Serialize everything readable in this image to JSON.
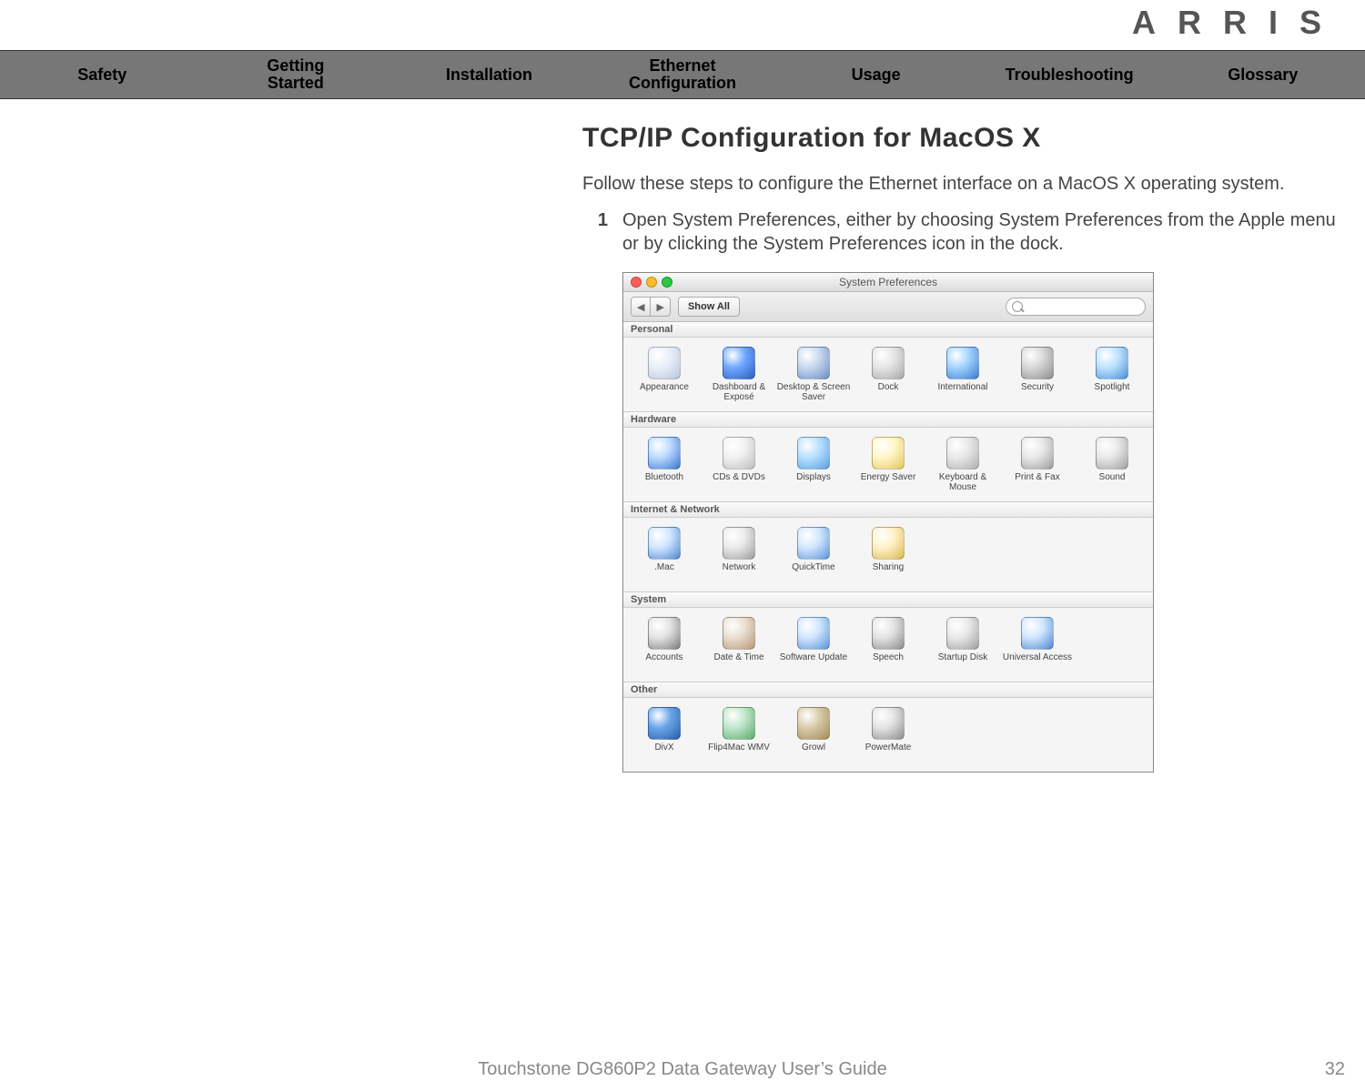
{
  "brand": "ARRIS",
  "nav": {
    "items": [
      {
        "label": "Safety"
      },
      {
        "label": "Getting\nStarted"
      },
      {
        "label": "Installation"
      },
      {
        "label": "Ethernet\nConfiguration"
      },
      {
        "label": "Usage"
      },
      {
        "label": "Troubleshooting"
      },
      {
        "label": "Glossary"
      }
    ]
  },
  "page": {
    "heading": "TCP/IP Configuration for MacOS X",
    "intro": "Follow these steps to configure the Ethernet interface on a MacOS X operating system.",
    "step1_num": "1",
    "step1_txt": "Open System Preferences, either by choosing System Preferences from the Apple menu or by clicking the System Preferences icon in the dock."
  },
  "sys_prefs": {
    "window_title": "System Preferences",
    "toolbar": {
      "show_all": "Show All",
      "search_placeholder": ""
    },
    "sections": [
      {
        "title": "Personal",
        "items": [
          {
            "label": "Appearance",
            "glyph": "",
            "c1": "#e9eef7",
            "c2": "#b9c6de"
          },
          {
            "label": "Dashboard & Exposé",
            "glyph": "",
            "c1": "#6fa8ff",
            "c2": "#2d5fbf"
          },
          {
            "label": "Desktop & Screen Saver",
            "glyph": "",
            "c1": "#c7d8ee",
            "c2": "#6b8ec8"
          },
          {
            "label": "Dock",
            "glyph": "",
            "c1": "#e5e5e5",
            "c2": "#a8a8a8"
          },
          {
            "label": "International",
            "glyph": "",
            "c1": "#a3d4ff",
            "c2": "#3a7bd2"
          },
          {
            "label": "Security",
            "glyph": "",
            "c1": "#d7d7d7",
            "c2": "#8e8e8e"
          },
          {
            "label": "Spotlight",
            "glyph": "",
            "c1": "#bfe2ff",
            "c2": "#4a8fd6"
          }
        ]
      },
      {
        "title": "Hardware",
        "items": [
          {
            "label": "Bluetooth",
            "glyph": "",
            "c1": "#bcd9ff",
            "c2": "#3a78d0"
          },
          {
            "label": "CDs & DVDs",
            "glyph": "",
            "c1": "#f1f1f1",
            "c2": "#bdbdbd"
          },
          {
            "label": "Displays",
            "glyph": "",
            "c1": "#b7e0ff",
            "c2": "#5aa0e2"
          },
          {
            "label": "Energy Saver",
            "glyph": "",
            "c1": "#fff7c8",
            "c2": "#e3c65a"
          },
          {
            "label": "Keyboard & Mouse",
            "glyph": "",
            "c1": "#e8e8e8",
            "c2": "#b0b0b0"
          },
          {
            "label": "Print & Fax",
            "glyph": "",
            "c1": "#e8e8e8",
            "c2": "#9d9d9d"
          },
          {
            "label": "Sound",
            "glyph": "",
            "c1": "#e8e8e8",
            "c2": "#a0a0a0"
          }
        ]
      },
      {
        "title": "Internet & Network",
        "items": [
          {
            "label": ".Mac",
            "glyph": "",
            "c1": "#cfe5ff",
            "c2": "#4f86d2"
          },
          {
            "label": "Network",
            "glyph": "",
            "c1": "#eaeaea",
            "c2": "#9e9e9e"
          },
          {
            "label": "QuickTime",
            "glyph": "",
            "c1": "#d1e7ff",
            "c2": "#5b93d8"
          },
          {
            "label": "Sharing",
            "glyph": "",
            "c1": "#fff1c8",
            "c2": "#d9b84e"
          }
        ]
      },
      {
        "title": "System",
        "items": [
          {
            "label": "Accounts",
            "glyph": "",
            "c1": "#e2e2e2",
            "c2": "#7d7d7d"
          },
          {
            "label": "Date & Time",
            "glyph": "",
            "c1": "#e9ded1",
            "c2": "#b99875"
          },
          {
            "label": "Software Update",
            "glyph": "",
            "c1": "#cfe5ff",
            "c2": "#5a93d8"
          },
          {
            "label": "Speech",
            "glyph": "",
            "c1": "#e2e2e2",
            "c2": "#8b8b8b"
          },
          {
            "label": "Startup Disk",
            "glyph": "",
            "c1": "#e8e8e8",
            "c2": "#a0a0a0"
          },
          {
            "label": "Universal Access",
            "glyph": "",
            "c1": "#cfe5ff",
            "c2": "#4f86d2"
          }
        ]
      },
      {
        "title": "Other",
        "items": [
          {
            "label": "DivX",
            "glyph": "",
            "c1": "#6aa6e8",
            "c2": "#2c5ea8"
          },
          {
            "label": "Flip4Mac WMV",
            "glyph": "",
            "c1": "#bfe6c8",
            "c2": "#5bab6e"
          },
          {
            "label": "Growl",
            "glyph": "",
            "c1": "#d8cba8",
            "c2": "#a38c5a"
          },
          {
            "label": "PowerMate",
            "glyph": "",
            "c1": "#e2e2e2",
            "c2": "#8e8e8e"
          }
        ]
      }
    ]
  },
  "footer": {
    "title": "Touchstone DG860P2 Data Gateway User’s Guide",
    "page": "32"
  }
}
